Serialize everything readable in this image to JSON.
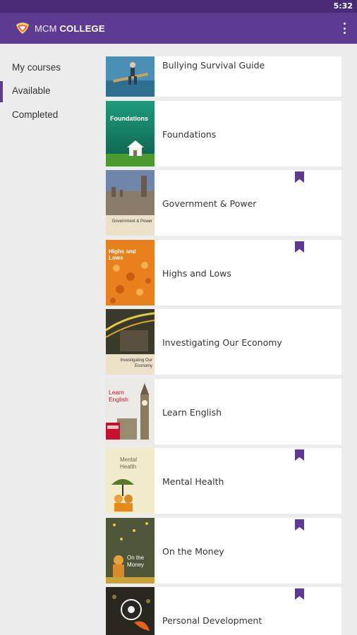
{
  "status_bar": {
    "time": "5:32"
  },
  "app_bar": {
    "brand_light": "MCM",
    "brand_bold": "COLLEGE",
    "menu_icon": "more-vert-icon",
    "accent_color": "#5e3b93"
  },
  "sidebar": {
    "items": [
      {
        "label": "My courses",
        "active": false
      },
      {
        "label": "Available",
        "active": true
      },
      {
        "label": "Completed",
        "active": false
      }
    ]
  },
  "courses": [
    {
      "title": "Bullying Survival Guide",
      "bookmarked": false,
      "thumb_text": ""
    },
    {
      "title": "Foundations",
      "bookmarked": false,
      "thumb_text": "Foundations"
    },
    {
      "title": "Government & Power",
      "bookmarked": true,
      "thumb_text": "Government & Power"
    },
    {
      "title": "Highs and Lows",
      "bookmarked": true,
      "thumb_text": "Highs and Lows"
    },
    {
      "title": "Investigating Our Economy",
      "bookmarked": false,
      "thumb_text": "Investigating Our Economy"
    },
    {
      "title": "Learn English",
      "bookmarked": false,
      "thumb_text": "Learn English"
    },
    {
      "title": "Mental Health",
      "bookmarked": true,
      "thumb_text": "Mental Health"
    },
    {
      "title": "On the Money",
      "bookmarked": true,
      "thumb_text": "On the Money"
    },
    {
      "title": "Personal Development",
      "bookmarked": true,
      "thumb_text": ""
    }
  ],
  "bookmark_icon": "bookmark-icon",
  "bookmark_color": "#5e3b93"
}
